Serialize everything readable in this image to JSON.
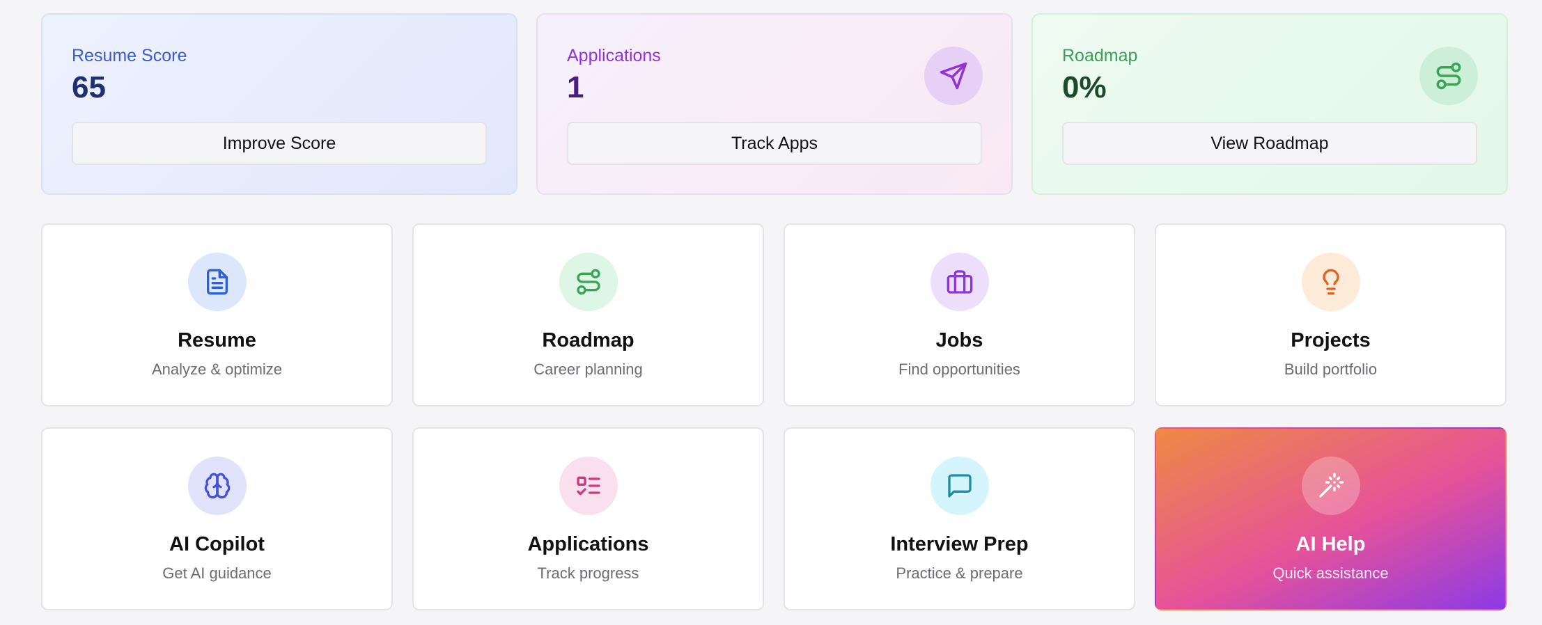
{
  "stats": [
    {
      "label": "Resume Score",
      "value": "65",
      "button": "Improve Score",
      "icon": ""
    },
    {
      "label": "Applications",
      "value": "1",
      "button": "Track Apps",
      "icon": "send-icon"
    },
    {
      "label": "Roadmap",
      "value": "0%",
      "button": "View Roadmap",
      "icon": "route-icon"
    }
  ],
  "features": [
    {
      "title": "Resume",
      "subtitle": "Analyze & optimize",
      "icon": "file-text-icon",
      "color": "#2f5fd6"
    },
    {
      "title": "Roadmap",
      "subtitle": "Career planning",
      "icon": "route-icon",
      "color": "#3aa455"
    },
    {
      "title": "Jobs",
      "subtitle": "Find opportunities",
      "icon": "briefcase-icon",
      "color": "#8e36d9"
    },
    {
      "title": "Projects",
      "subtitle": "Build portfolio",
      "icon": "lightbulb-icon",
      "color": "#e0641f"
    },
    {
      "title": "AI Copilot",
      "subtitle": "Get AI guidance",
      "icon": "brain-icon",
      "color": "#4650d9"
    },
    {
      "title": "Applications",
      "subtitle": "Track progress",
      "icon": "list-checks-icon",
      "color": "#cc3a7e"
    },
    {
      "title": "Interview Prep",
      "subtitle": "Practice & prepare",
      "icon": "message-square-icon",
      "color": "#1e8ea6"
    },
    {
      "title": "AI Help",
      "subtitle": "Quick assistance",
      "icon": "wand-sparkles-icon",
      "color": "#ffffff"
    }
  ]
}
